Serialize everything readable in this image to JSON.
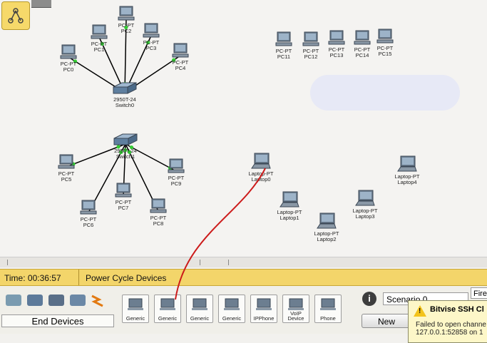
{
  "workspace": {
    "switches": [
      {
        "model": "2950T-24",
        "name": "Switch0"
      },
      {
        "model": "2950T-24",
        "name": "Switch1"
      }
    ],
    "pcs": [
      {
        "type": "PC-PT",
        "name": "PC0"
      },
      {
        "type": "PC-PT",
        "name": "PC1"
      },
      {
        "type": "PC-PT",
        "name": "PC2"
      },
      {
        "type": "PC-PT",
        "name": "PC3"
      },
      {
        "type": "PC-PT",
        "name": "PC4"
      },
      {
        "type": "PC-PT",
        "name": "PC5"
      },
      {
        "type": "PC-PT",
        "name": "PC6"
      },
      {
        "type": "PC-PT",
        "name": "PC7"
      },
      {
        "type": "PC-PT",
        "name": "PC8"
      },
      {
        "type": "PC-PT",
        "name": "PC9"
      },
      {
        "type": "PC-PT",
        "name": "PC11"
      },
      {
        "type": "PC-PT",
        "name": "PC12"
      },
      {
        "type": "PC-PT",
        "name": "PC13"
      },
      {
        "type": "PC-PT",
        "name": "PC14"
      },
      {
        "type": "PC-PT",
        "name": "PC15"
      }
    ],
    "laptops": [
      {
        "type": "Laptop-PT",
        "name": "Laptop0"
      },
      {
        "type": "Laptop-PT",
        "name": "Laptop1"
      },
      {
        "type": "Laptop-PT",
        "name": "Laptop2"
      },
      {
        "type": "Laptop-PT",
        "name": "Laptop3"
      },
      {
        "type": "Laptop-PT",
        "name": "Laptop4"
      }
    ]
  },
  "status": {
    "time": "Time: 00:36:57",
    "power_cycle": "Power Cycle Devices"
  },
  "bottom": {
    "category_label": "End Devices",
    "devices": [
      "Generic",
      "Generic",
      "Generic",
      "Generic",
      "IPPhone",
      "VoIP Device",
      "Phone"
    ],
    "scenario_value": "Scenario 0",
    "fire_value": "Fire",
    "new_label": "New",
    "info_icon": "i"
  },
  "notification": {
    "title": "Bitvise SSH Cl",
    "body_line1": "Failed to open channe",
    "body_line2": "127.0.0.1:52858 on 1"
  },
  "colors": {
    "status_bar": "#f3d56a",
    "link": "#000000",
    "link_led": "#33cc33",
    "annotation": "#cc1a1a"
  }
}
